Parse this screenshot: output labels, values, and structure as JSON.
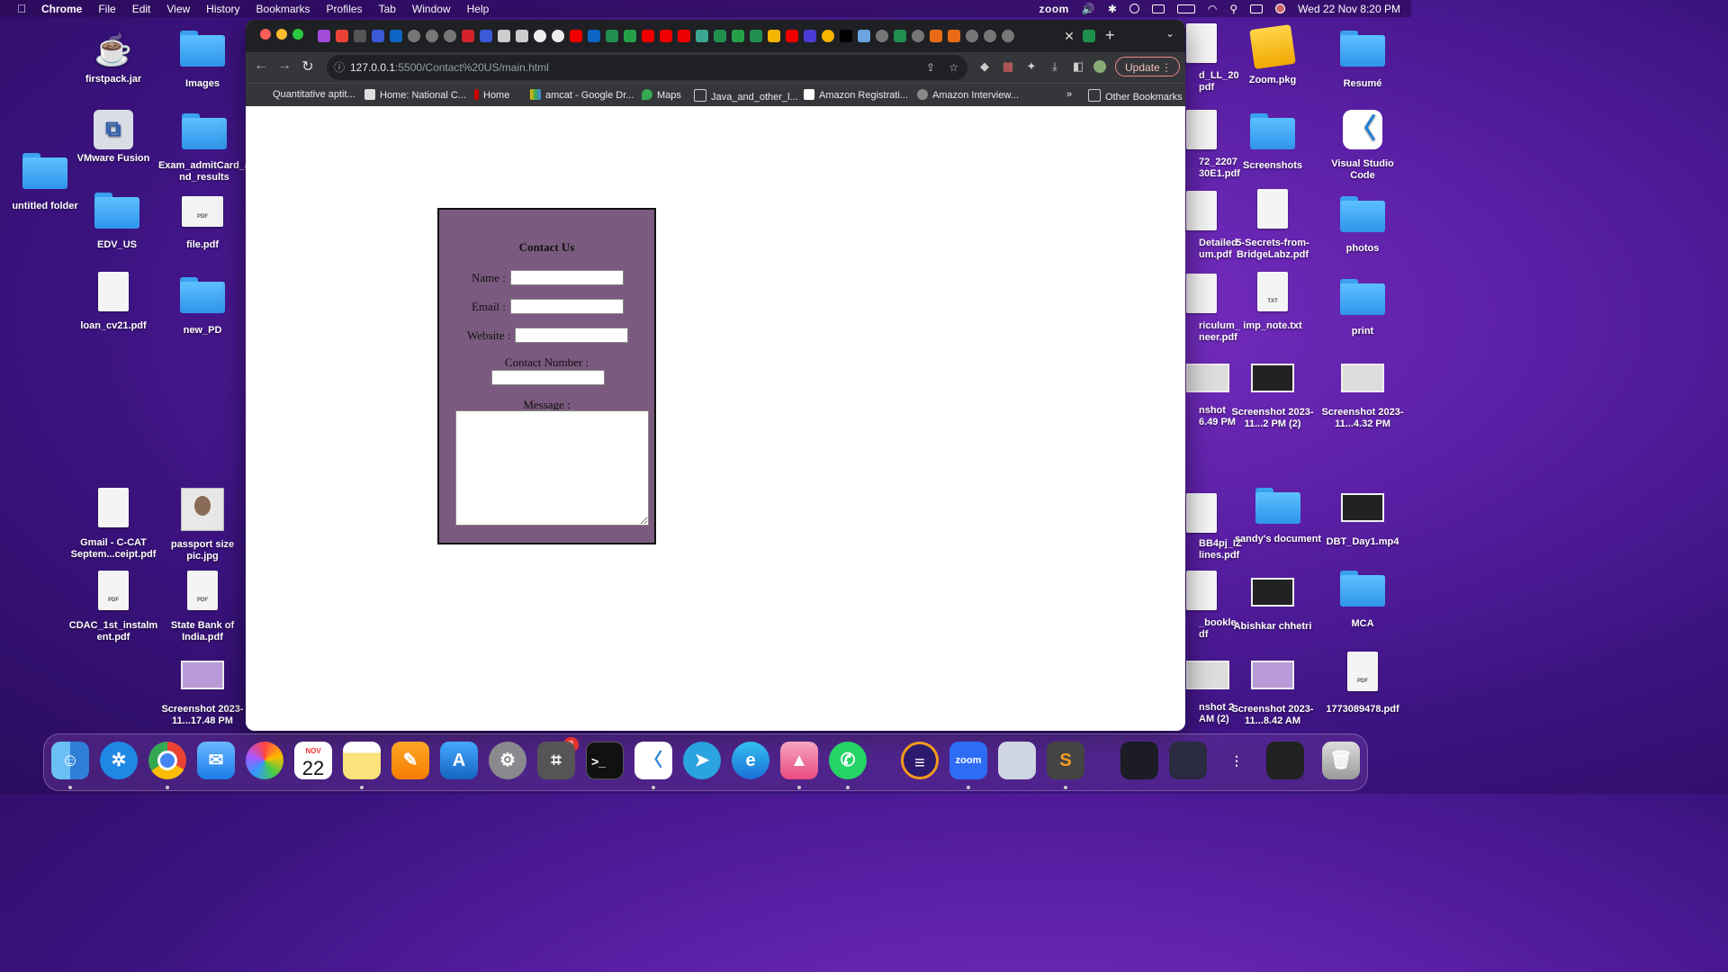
{
  "menubar": {
    "app": "Chrome",
    "items": [
      "File",
      "Edit",
      "View",
      "History",
      "Bookmarks",
      "Profiles",
      "Tab",
      "Window",
      "Help"
    ],
    "zoom_label": "zoom",
    "datetime": "Wed 22 Nov  8:20 PM"
  },
  "desktop_left": [
    {
      "label": "firstpack.jar",
      "icon": "coffee-cup-icon"
    },
    {
      "label": "Images",
      "icon": "folder-icon"
    },
    {
      "label": "VMware Fusion",
      "icon": "vmware-icon"
    },
    {
      "label": "Exam_admitCard_and_results",
      "icon": "folder-icon"
    },
    {
      "label": "untitled folder",
      "icon": "folder-icon"
    },
    {
      "label": "EDV_US",
      "icon": "folder-icon"
    },
    {
      "label": "file.pdf",
      "icon": "pdf-icon"
    },
    {
      "label": "loan_cv21.pdf",
      "icon": "pdf-icon"
    },
    {
      "label": "new_PD",
      "icon": "folder-icon"
    },
    {
      "label": "Gmail - C-CAT Septem...ceipt.pdf",
      "icon": "pdf-icon"
    },
    {
      "label": "passport size pic.jpg",
      "icon": "image-icon"
    },
    {
      "label": "CDAC_1st_instalment.pdf",
      "icon": "pdf-icon"
    },
    {
      "label": "State Bank of India.pdf",
      "icon": "pdf-icon"
    },
    {
      "label": "Screenshot 2023-11...17.48 PM",
      "icon": "screenshot-icon"
    }
  ],
  "desktop_right": [
    {
      "label": "d_LL_20 pdf"
    },
    {
      "label": "Zoom.pkg"
    },
    {
      "label": "Resumé"
    },
    {
      "label": "72_2207 30E1.pdf"
    },
    {
      "label": "Screenshots"
    },
    {
      "label": "Visual Studio Code"
    },
    {
      "label": "Detailed um.pdf"
    },
    {
      "label": "5-Secrets-from-BridgeLabz.pdf"
    },
    {
      "label": "photos"
    },
    {
      "label": "riculum_ neer.pdf"
    },
    {
      "label": "imp_note.txt"
    },
    {
      "label": "print"
    },
    {
      "label": "nshot 6.49 PM"
    },
    {
      "label": "Screenshot 2023-11...2 PM (2)"
    },
    {
      "label": "Screenshot 2023-11...4.32 PM"
    },
    {
      "label": "BB4pj_IZ lines.pdf"
    },
    {
      "label": "sandy's document"
    },
    {
      "label": "DBT_Day1.mp4"
    },
    {
      "label": "_bookle df"
    },
    {
      "label": "Abishkar chhetri"
    },
    {
      "label": "MCA"
    },
    {
      "label": "nshot 2 AM (2)"
    },
    {
      "label": "Screenshot 2023-11...8.42 AM"
    },
    {
      "label": "1773089478.pdf"
    }
  ],
  "browser": {
    "url_host": "127.0.0.1",
    "url_rest": ":5500/Contact%20US/main.html",
    "update_label": "Update",
    "bookmarks": [
      "Quantitative aptit...",
      "Home: National C...",
      "Home",
      "amcat - Google Dr...",
      "Maps",
      "Java_and_other_l...",
      "Amazon Registrati...",
      "Amazon Interview..."
    ],
    "overflow": "»",
    "other_bookmarks": "Other Bookmarks"
  },
  "form": {
    "title": "Contact Us",
    "name_label": "Name :",
    "email_label": "Email :",
    "website_label": "Website :",
    "contact_label": "Contact Number :",
    "message_label": "Message :"
  },
  "dock": {
    "calendar_month": "NOV",
    "calendar_day": "22",
    "settings_badge": "2",
    "zoom_label": "zoom"
  },
  "colors": {
    "form_bg": "#7a5a7e",
    "desktop_accent": "#5a1fa5"
  }
}
